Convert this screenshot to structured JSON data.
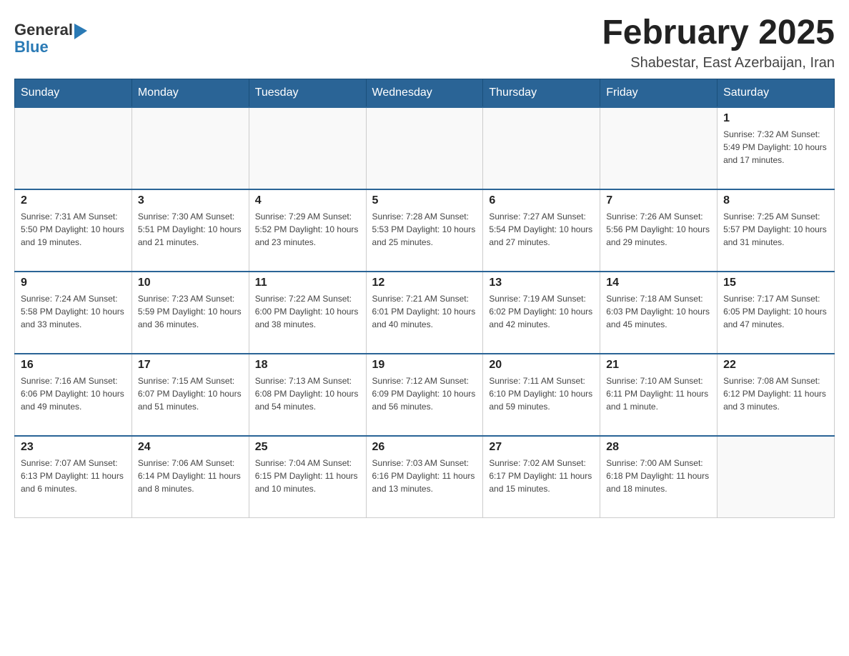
{
  "header": {
    "logo_general": "General",
    "logo_blue": "Blue",
    "month_title": "February 2025",
    "location": "Shabestar, East Azerbaijan, Iran"
  },
  "days_of_week": [
    "Sunday",
    "Monday",
    "Tuesday",
    "Wednesday",
    "Thursday",
    "Friday",
    "Saturday"
  ],
  "weeks": [
    [
      {
        "day": "",
        "info": ""
      },
      {
        "day": "",
        "info": ""
      },
      {
        "day": "",
        "info": ""
      },
      {
        "day": "",
        "info": ""
      },
      {
        "day": "",
        "info": ""
      },
      {
        "day": "",
        "info": ""
      },
      {
        "day": "1",
        "info": "Sunrise: 7:32 AM\nSunset: 5:49 PM\nDaylight: 10 hours and 17 minutes."
      }
    ],
    [
      {
        "day": "2",
        "info": "Sunrise: 7:31 AM\nSunset: 5:50 PM\nDaylight: 10 hours and 19 minutes."
      },
      {
        "day": "3",
        "info": "Sunrise: 7:30 AM\nSunset: 5:51 PM\nDaylight: 10 hours and 21 minutes."
      },
      {
        "day": "4",
        "info": "Sunrise: 7:29 AM\nSunset: 5:52 PM\nDaylight: 10 hours and 23 minutes."
      },
      {
        "day": "5",
        "info": "Sunrise: 7:28 AM\nSunset: 5:53 PM\nDaylight: 10 hours and 25 minutes."
      },
      {
        "day": "6",
        "info": "Sunrise: 7:27 AM\nSunset: 5:54 PM\nDaylight: 10 hours and 27 minutes."
      },
      {
        "day": "7",
        "info": "Sunrise: 7:26 AM\nSunset: 5:56 PM\nDaylight: 10 hours and 29 minutes."
      },
      {
        "day": "8",
        "info": "Sunrise: 7:25 AM\nSunset: 5:57 PM\nDaylight: 10 hours and 31 minutes."
      }
    ],
    [
      {
        "day": "9",
        "info": "Sunrise: 7:24 AM\nSunset: 5:58 PM\nDaylight: 10 hours and 33 minutes."
      },
      {
        "day": "10",
        "info": "Sunrise: 7:23 AM\nSunset: 5:59 PM\nDaylight: 10 hours and 36 minutes."
      },
      {
        "day": "11",
        "info": "Sunrise: 7:22 AM\nSunset: 6:00 PM\nDaylight: 10 hours and 38 minutes."
      },
      {
        "day": "12",
        "info": "Sunrise: 7:21 AM\nSunset: 6:01 PM\nDaylight: 10 hours and 40 minutes."
      },
      {
        "day": "13",
        "info": "Sunrise: 7:19 AM\nSunset: 6:02 PM\nDaylight: 10 hours and 42 minutes."
      },
      {
        "day": "14",
        "info": "Sunrise: 7:18 AM\nSunset: 6:03 PM\nDaylight: 10 hours and 45 minutes."
      },
      {
        "day": "15",
        "info": "Sunrise: 7:17 AM\nSunset: 6:05 PM\nDaylight: 10 hours and 47 minutes."
      }
    ],
    [
      {
        "day": "16",
        "info": "Sunrise: 7:16 AM\nSunset: 6:06 PM\nDaylight: 10 hours and 49 minutes."
      },
      {
        "day": "17",
        "info": "Sunrise: 7:15 AM\nSunset: 6:07 PM\nDaylight: 10 hours and 51 minutes."
      },
      {
        "day": "18",
        "info": "Sunrise: 7:13 AM\nSunset: 6:08 PM\nDaylight: 10 hours and 54 minutes."
      },
      {
        "day": "19",
        "info": "Sunrise: 7:12 AM\nSunset: 6:09 PM\nDaylight: 10 hours and 56 minutes."
      },
      {
        "day": "20",
        "info": "Sunrise: 7:11 AM\nSunset: 6:10 PM\nDaylight: 10 hours and 59 minutes."
      },
      {
        "day": "21",
        "info": "Sunrise: 7:10 AM\nSunset: 6:11 PM\nDaylight: 11 hours and 1 minute."
      },
      {
        "day": "22",
        "info": "Sunrise: 7:08 AM\nSunset: 6:12 PM\nDaylight: 11 hours and 3 minutes."
      }
    ],
    [
      {
        "day": "23",
        "info": "Sunrise: 7:07 AM\nSunset: 6:13 PM\nDaylight: 11 hours and 6 minutes."
      },
      {
        "day": "24",
        "info": "Sunrise: 7:06 AM\nSunset: 6:14 PM\nDaylight: 11 hours and 8 minutes."
      },
      {
        "day": "25",
        "info": "Sunrise: 7:04 AM\nSunset: 6:15 PM\nDaylight: 11 hours and 10 minutes."
      },
      {
        "day": "26",
        "info": "Sunrise: 7:03 AM\nSunset: 6:16 PM\nDaylight: 11 hours and 13 minutes."
      },
      {
        "day": "27",
        "info": "Sunrise: 7:02 AM\nSunset: 6:17 PM\nDaylight: 11 hours and 15 minutes."
      },
      {
        "day": "28",
        "info": "Sunrise: 7:00 AM\nSunset: 6:18 PM\nDaylight: 11 hours and 18 minutes."
      },
      {
        "day": "",
        "info": ""
      }
    ]
  ]
}
